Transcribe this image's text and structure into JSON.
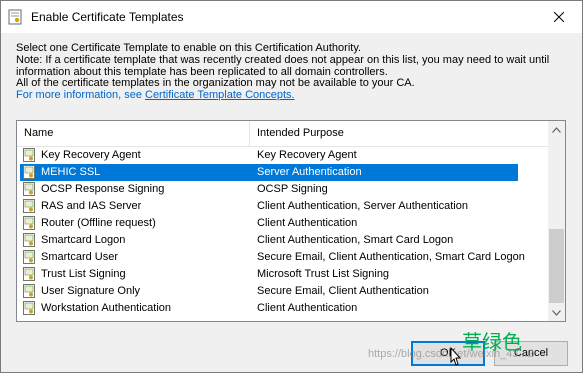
{
  "window": {
    "title": "Enable Certificate Templates"
  },
  "description": {
    "lines": [
      "Select one Certificate Template to enable on this Certification Authority.",
      "Note: If a certificate template that was recently created does not appear on this list, you may need to wait until",
      "information about this template has been replicated to all domain controllers.",
      "All of the certificate templates in the organization may not be available to your CA."
    ],
    "more_info_prefix": "For more information, see ",
    "more_info_link": "Certificate Template Concepts."
  },
  "list": {
    "columns": [
      "Name",
      "Intended Purpose"
    ],
    "rows": [
      {
        "name": "Key Recovery Agent",
        "purpose": "Key Recovery Agent"
      },
      {
        "name": "MEHIC SSL",
        "purpose": "Server Authentication"
      },
      {
        "name": "OCSP Response Signing",
        "purpose": "OCSP Signing"
      },
      {
        "name": "RAS and IAS Server",
        "purpose": "Client Authentication, Server Authentication"
      },
      {
        "name": "Router (Offline request)",
        "purpose": "Client Authentication"
      },
      {
        "name": "Smartcard Logon",
        "purpose": "Client Authentication, Smart Card Logon"
      },
      {
        "name": "Smartcard User",
        "purpose": "Secure Email, Client Authentication, Smart Card Logon"
      },
      {
        "name": "Trust List Signing",
        "purpose": "Microsoft Trust List Signing"
      },
      {
        "name": "User Signature Only",
        "purpose": "Secure Email, Client Authentication"
      },
      {
        "name": "Workstation Authentication",
        "purpose": "Client Authentication"
      }
    ],
    "selected_row": "MEHIC SSL",
    "row_icon": "certificate-template-icon"
  },
  "buttons": {
    "ok": "OK",
    "cancel": "Cancel"
  },
  "overlays": {
    "watermark": "https://blog.csdn.net/weixin_43...2",
    "stamp": "草绿色"
  },
  "colors": {
    "selection": "#0078d7",
    "link": "#0066cc",
    "stamp": "#00b050"
  }
}
